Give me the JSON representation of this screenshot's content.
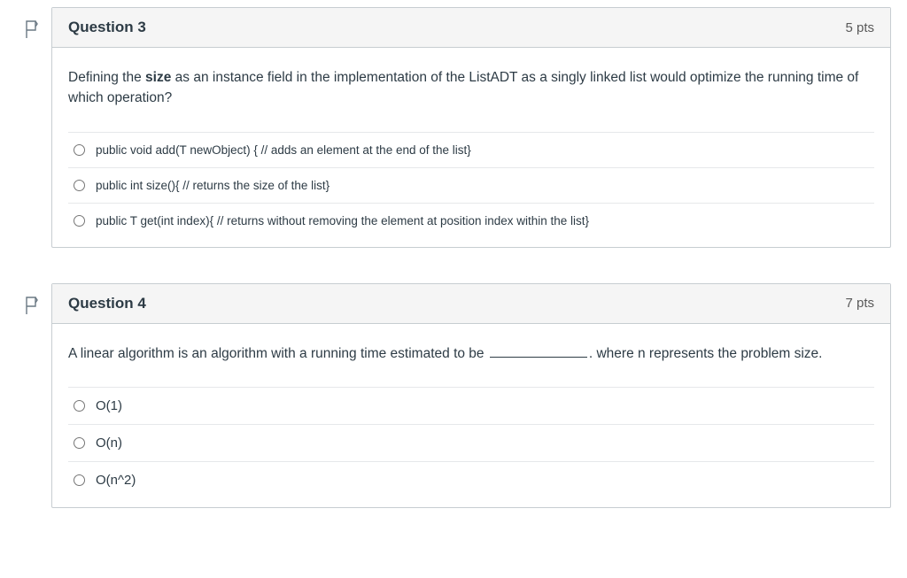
{
  "questions": [
    {
      "title": "Question 3",
      "points": "5 pts",
      "prompt_pre": "Defining the ",
      "prompt_bold": "size",
      "prompt_post": " as an instance field in the implementation of the ListADT as a singly linked list would optimize the running time of which operation?",
      "answers_style": "small",
      "answers": [
        "public void add(T newObject) { // adds an element at the end of the list}",
        "public int size(){ // returns the size of the list}",
        "public T get(int index){ // returns without removing the element at position index within the list}"
      ]
    },
    {
      "title": "Question 4",
      "points": "7 pts",
      "prompt_pre": "A linear algorithm is an algorithm with a running time estimated to be ",
      "prompt_blank": true,
      "prompt_post": ". where n represents the problem size.",
      "answers_style": "normal",
      "answers": [
        "O(1)",
        "O(n)",
        "O(n^2)"
      ]
    }
  ]
}
